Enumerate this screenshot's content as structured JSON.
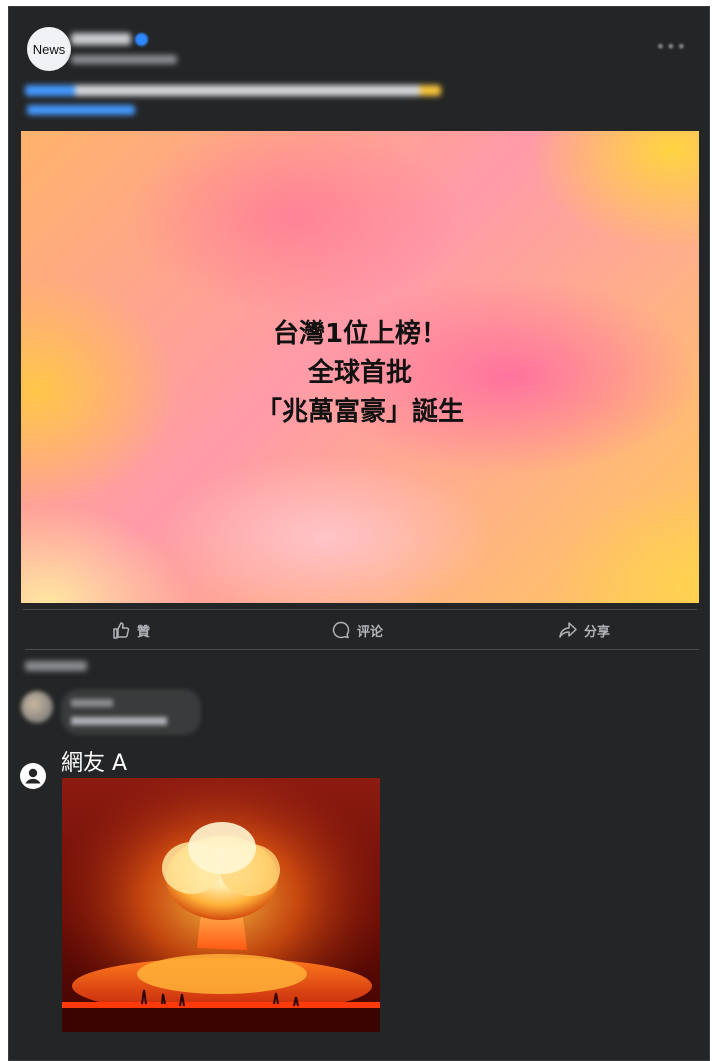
{
  "post": {
    "avatar_text": "News",
    "hero_lines": [
      "台灣1位上榜！",
      "全球首批",
      "「兆萬富豪」誕生"
    ]
  },
  "actions": {
    "like": "贊",
    "comment": "评论",
    "share": "分享"
  },
  "reply": {
    "name": "網友 A",
    "image_alt": "nuclear-explosion"
  },
  "colors": {
    "card_bg": "#242526",
    "action_text": "#b0b3b8",
    "link_blue": "#4599ff"
  }
}
